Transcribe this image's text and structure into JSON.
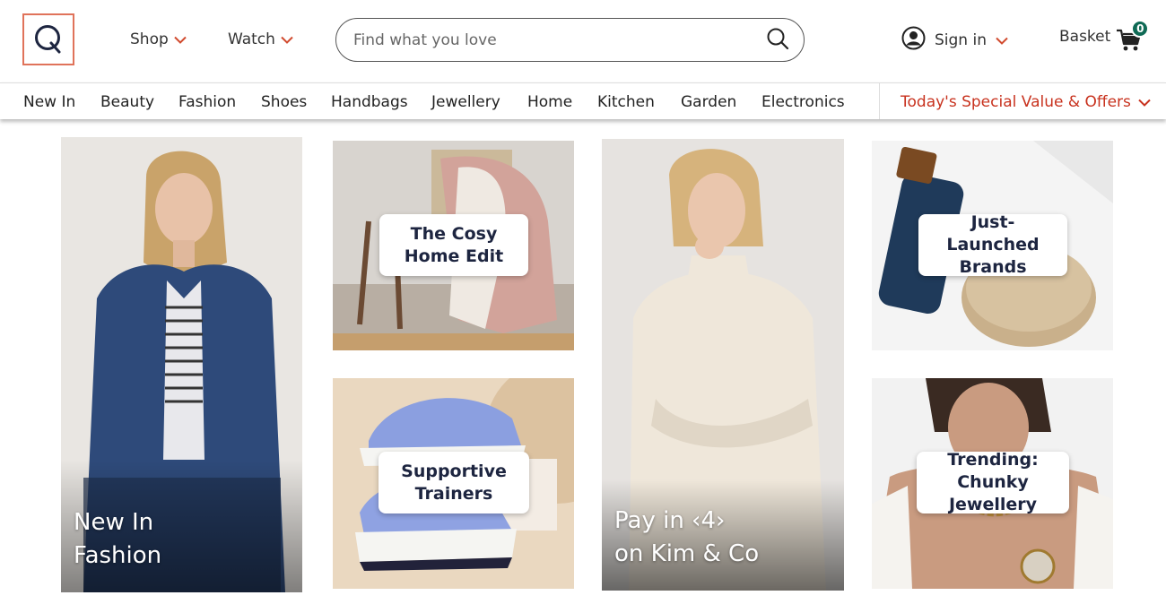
{
  "header": {
    "logo_letter": "Q",
    "shop_label": "Shop",
    "watch_label": "Watch",
    "search_placeholder": "Find what you love",
    "signin_label": "Sign in",
    "basket_label": "Basket",
    "basket_count": "0"
  },
  "categories": [
    "New In",
    "Beauty",
    "Fashion",
    "Shoes",
    "Handbags",
    "Jewellery",
    "Home",
    "Kitchen",
    "Garden",
    "Electronics"
  ],
  "offers_label": "Today's Special Value & Offers",
  "tiles": {
    "new_in_fashion": {
      "line1": "New In",
      "line2": "Fashion"
    },
    "cosy_home": {
      "line1": "The Cosy",
      "line2": "Home Edit"
    },
    "trainers": {
      "line1": "Supportive",
      "line2": "Trainers"
    },
    "pay_in_4": {
      "line1": "Pay in ‹4›",
      "line2": "on Kim & Co"
    },
    "brands": {
      "line1": "Just-Launched",
      "line2": "Brands"
    },
    "jewellery": {
      "line1": "Trending:",
      "line2": "Chunky Jewellery"
    }
  },
  "colors": {
    "brand_accent": "#d14a2e",
    "offers_red": "#c8321e",
    "cart_badge": "#0f6a55",
    "logo_border": "#e0735a",
    "card_text": "#1d2540"
  },
  "icons": [
    "search-icon",
    "user-icon",
    "cart-icon",
    "chevron-down-icon"
  ]
}
